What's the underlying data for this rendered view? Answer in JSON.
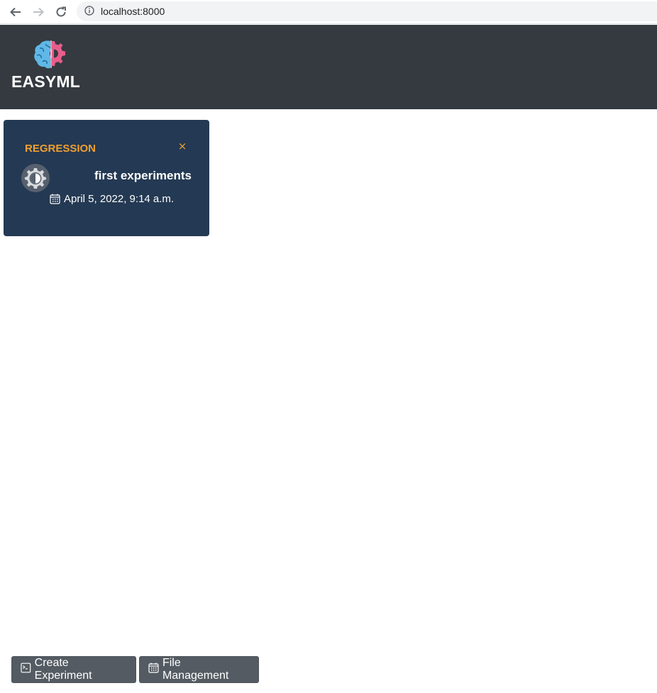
{
  "browser": {
    "url": "localhost:8000"
  },
  "header": {
    "brand": "EASYML",
    "logo_icon": "brain-gear-logo"
  },
  "experiments": [
    {
      "type": "REGRESSION",
      "close_symbol": "×",
      "name": "first experiments",
      "date": "April 5, 2022, 9:14 a.m.",
      "icon": "contrast-gear-icon"
    }
  ],
  "actions": {
    "create_label": "Create Experiment",
    "files_label": "File Management"
  },
  "colors": {
    "header_bg": "#343a40",
    "card_bg": "#243953",
    "accent": "#f0a030",
    "button_bg": "#545b62"
  }
}
